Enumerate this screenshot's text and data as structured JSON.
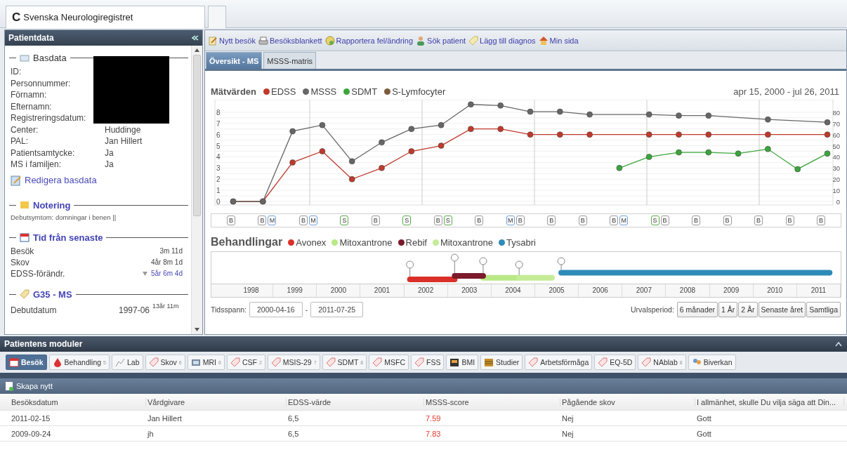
{
  "window": {
    "logo": "C",
    "title": "Svenska Neurologiregistret"
  },
  "patient_panel": {
    "title": "Patientdata",
    "basdata": {
      "title": "Basdata",
      "fields": [
        {
          "label": "ID:"
        },
        {
          "label": "Personnummer:"
        },
        {
          "label": "Förnamn:"
        },
        {
          "label": "Efternamn:"
        },
        {
          "label": "Registreringsdatum:"
        },
        {
          "label": "Center:",
          "value": "Huddinge"
        },
        {
          "label": "PAL:",
          "value": "Jan Hillert"
        },
        {
          "label": "Patientsamtycke:",
          "value": "Ja"
        },
        {
          "label": "MS i familjen:",
          "value": "Ja"
        }
      ],
      "edit_link": "Redigera basdata"
    },
    "notering": {
      "title": "Notering",
      "text": "Debutsymtom: domningar i benen ||"
    },
    "tid": {
      "title": "Tid från senaste",
      "rows": [
        {
          "label": "Besök",
          "value": "3m 11d",
          "kind": "plain"
        },
        {
          "label": "Skov",
          "value": "4år 8m 1d",
          "kind": "plain"
        },
        {
          "label": "EDSS-förändr.",
          "value": "5år 6m 4d",
          "kind": "trend"
        }
      ]
    },
    "diagnos": {
      "title": "G35 - MS",
      "rows": [
        {
          "label": "Debutdatum",
          "value": "1997-06",
          "note": "13år 11m"
        }
      ]
    }
  },
  "toolbar": [
    "Nytt besök",
    "Besöksblankett",
    "Rapportera fel/ändring",
    "Sök patient",
    "Lägg till diagnos",
    "Min sida"
  ],
  "view_tabs": [
    {
      "label": "Översikt - MS",
      "selected": true
    },
    {
      "label": "MSSS-matris",
      "selected": false
    }
  ],
  "measurements": {
    "date_range": "apr 15, 2000 - jul 26, 2011",
    "chart_data": {
      "type": "line",
      "title": "Mätvärden",
      "categories": [
        null,
        null,
        null,
        null,
        null,
        null,
        null,
        null,
        null,
        null,
        null,
        null,
        null,
        null,
        null,
        null,
        null,
        null,
        null,
        null,
        null
      ],
      "series": [
        {
          "name": "EDSS",
          "color": "#c0392b",
          "marker": "circle",
          "values": [
            0,
            0,
            3.5,
            4.5,
            2.0,
            3.0,
            4.5,
            5.0,
            6.5,
            6.5,
            6.0,
            6.0,
            6.0,
            null,
            6.0,
            6.0,
            6.0,
            null,
            6.0,
            null,
            6.0
          ]
        },
        {
          "name": "MSSS",
          "color": "#666666",
          "marker": "circle",
          "values": [
            0,
            0,
            6.3,
            6.85,
            3.6,
            5.3,
            6.5,
            6.85,
            8.7,
            8.6,
            8.05,
            8.05,
            7.8,
            null,
            7.8,
            7.7,
            7.7,
            null,
            7.35,
            null,
            7.1
          ]
        },
        {
          "name": "SDMT",
          "color": "#3aa53a",
          "axis": "y2",
          "marker": "circle",
          "values": [
            null,
            null,
            null,
            null,
            null,
            null,
            null,
            null,
            null,
            null,
            null,
            null,
            null,
            30,
            40,
            44,
            44,
            43,
            47,
            29,
            43
          ]
        },
        {
          "name": "S-Lymfocyter",
          "color": "#7b5c3c",
          "values": [
            null,
            null,
            null,
            null,
            null,
            null,
            null,
            null,
            null,
            null,
            null,
            null,
            null,
            null,
            null,
            null,
            null,
            null,
            null,
            null,
            null
          ]
        }
      ],
      "grid": true,
      "ylim": [
        0,
        9
      ],
      "yticks": [
        0,
        1,
        2,
        3,
        4,
        5,
        6,
        7,
        8
      ],
      "y2lim": [
        0,
        90
      ],
      "y2ticks": [
        0,
        10,
        20,
        30,
        40,
        50,
        60,
        70,
        80
      ]
    },
    "visit_markers": [
      [
        {
          "label": "B",
          "color": "#9a9a9a"
        }
      ],
      [
        {
          "label": "B",
          "color": "#9a9a9a"
        },
        {
          "label": "M",
          "color": "#6f9fd8"
        }
      ],
      [
        {
          "label": "B",
          "color": "#9a9a9a"
        },
        {
          "label": "M",
          "color": "#6f9fd8"
        }
      ],
      [
        {
          "label": "S",
          "color": "#5aaa4a"
        }
      ],
      [
        {
          "label": "B",
          "color": "#9a9a9a"
        }
      ],
      [
        {
          "label": "S",
          "color": "#5aaa4a"
        }
      ],
      [
        {
          "label": "B",
          "color": "#9a9a9a"
        },
        {
          "label": "S",
          "color": "#5aaa4a"
        }
      ],
      [
        {
          "label": "B",
          "color": "#9a9a9a"
        }
      ],
      [
        {
          "label": "M",
          "color": "#6f9fd8"
        },
        {
          "label": "B",
          "color": "#9a9a9a"
        }
      ],
      [
        {
          "label": "B",
          "color": "#9a9a9a"
        }
      ],
      [
        {
          "label": "B",
          "color": "#9a9a9a"
        }
      ],
      [
        {
          "label": "B",
          "color": "#9a9a9a"
        },
        {
          "label": "M",
          "color": "#6f9fd8"
        }
      ],
      [
        {
          "label": "S",
          "color": "#5aaa4a"
        },
        {
          "label": "B",
          "color": "#9a9a9a"
        }
      ],
      [
        {
          "label": "B",
          "color": "#9a9a9a"
        }
      ],
      [
        {
          "label": "B",
          "color": "#9a9a9a"
        }
      ],
      [
        {
          "label": "B",
          "color": "#9a9a9a"
        }
      ],
      [
        {
          "label": "B",
          "color": "#9a9a9a"
        }
      ],
      [
        {
          "label": "B",
          "color": "#9a9a9a"
        }
      ]
    ]
  },
  "treatments": {
    "title": "Behandlingar",
    "legend": [
      {
        "name": "Avonex",
        "color": "#d9302a"
      },
      {
        "name": "Mitoxantrone",
        "color": "#b8e986"
      },
      {
        "name": "Rebif",
        "color": "#7a1a2a"
      },
      {
        "name": "Mitoxantrone",
        "color": "#c4ec96"
      },
      {
        "name": "Tysabri",
        "color": "#2e8bb8"
      }
    ],
    "years": [
      "1998",
      "1999",
      "2000",
      "2001",
      "2002",
      "2003",
      "2004",
      "2005",
      "2006",
      "2007",
      "2008",
      "2009",
      "2010",
      "2011"
    ]
  },
  "time_span": {
    "label": "Tidsspann:",
    "from": "2000-04-16",
    "separator": "-",
    "to": "2011-07-25"
  },
  "period": {
    "label": "Urvalsperiod:",
    "buttons": [
      "6 månader",
      "1 År",
      "2 År",
      "Senaste året",
      "Samtliga"
    ]
  },
  "modules": {
    "title": "Patientens moduler",
    "tabs": [
      {
        "label": "Besök",
        "selected": true
      },
      {
        "label": "Behandling",
        "count": "5",
        "selected": false
      },
      {
        "label": "Lab",
        "selected": false
      },
      {
        "label": "Skov",
        "count": "6",
        "selected": false
      },
      {
        "label": "MRI",
        "count": "6",
        "selected": false
      },
      {
        "label": "CSF",
        "count": "2",
        "selected": false
      },
      {
        "label": "MSIS-29",
        "count": "7",
        "selected": false
      },
      {
        "label": "SDMT",
        "count": "8",
        "selected": false
      },
      {
        "label": "MSFC",
        "selected": false
      },
      {
        "label": "FSS",
        "selected": false
      },
      {
        "label": "BMI",
        "selected": false
      },
      {
        "label": "Studier",
        "selected": false
      },
      {
        "label": "Arbetsförmåga",
        "selected": false
      },
      {
        "label": "EQ-5D",
        "selected": false
      },
      {
        "label": "NAblab",
        "count": "8",
        "selected": false
      },
      {
        "label": "Biverkan",
        "selected": false
      }
    ],
    "create_button": "Skapa nytt",
    "table": {
      "columns": [
        "Besöksdatum",
        "Vårdgivare",
        "EDSS-värde",
        "MSSS-score",
        "Pågående skov",
        "I allmänhet, skulle Du vilja säga att Din..."
      ],
      "rows": [
        [
          "2011-02-15",
          "Jan Hillert",
          "6,5",
          "7.59",
          "Nej",
          "Gott"
        ],
        [
          "2009-09-24",
          "jh",
          "6,5",
          "7.83",
          "Nej",
          "Gott"
        ]
      ]
    }
  }
}
